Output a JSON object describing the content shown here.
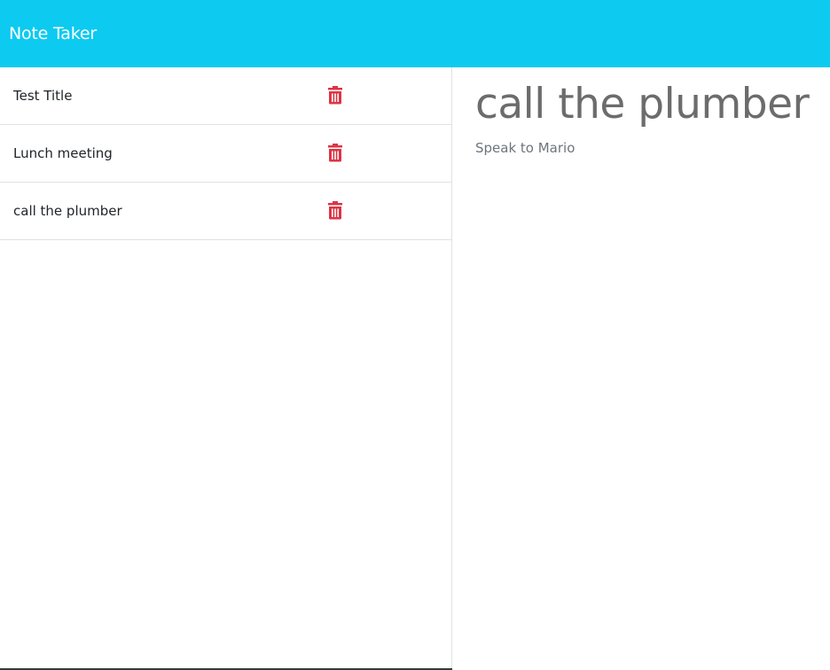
{
  "header": {
    "brand": "Note Taker",
    "background_color": "#0dcaf0"
  },
  "sidebar": {
    "notes": [
      {
        "title": "Test Title",
        "delete_icon": "trash-icon"
      },
      {
        "title": "Lunch meeting",
        "delete_icon": "trash-icon"
      },
      {
        "title": "call the plumber",
        "delete_icon": "trash-icon"
      }
    ],
    "delete_color": "#dc3545"
  },
  "main": {
    "note_title": "call the plumber",
    "note_text": "Speak to Mario"
  }
}
